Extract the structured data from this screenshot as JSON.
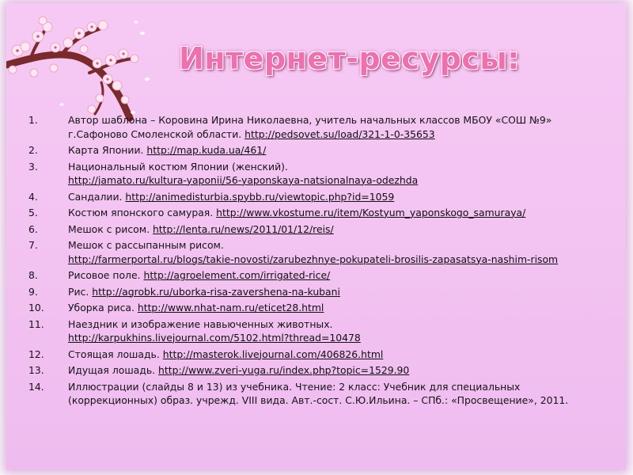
{
  "title": "Интернет-ресурсы:",
  "refs": [
    {
      "num": "1.",
      "text": "Автор шаблона – Коровина Ирина Николаевна, учитель начальных классов МБОУ «СОШ №9» г.Сафоново Смоленской области. ",
      "link": "http://pedsovet.su/load/321-1-0-35653",
      "after": ""
    },
    {
      "num": "2.",
      "text": "Карта Японии. ",
      "link": "http://map.kuda.ua/461/",
      "after": ""
    },
    {
      "num": "3.",
      "text": "Национальный костюм Японии (женский).",
      "link": "http://jamato.ru/kultura-yaponii/56-yaponskaya-natsionalnaya-odezhda",
      "after": ""
    },
    {
      "num": "4.",
      "text": "Сандалии. ",
      "link": "http://animedisturbia.spybb.ru/viewtopic.php?id=1059",
      "after": ""
    },
    {
      "num": "5.",
      "text": "Костюм японского самурая. ",
      "link": "http://www.vkostume.ru/item/Kostyum_yaponskogo_samuraya/",
      "after": ""
    },
    {
      "num": "6.",
      "text": "Мешок с рисом. ",
      "link": "http://lenta.ru/news/2011/01/12/reis/",
      "after": ""
    },
    {
      "num": "7.",
      "text": "Мешок с рассыпанным рисом.",
      "link": "http://farmerportal.ru/blogs/takie-novosti/zarubezhnye-pokupateli-brosilis-zapasatsya-nashim-risom",
      "after": ""
    },
    {
      "num": "8.",
      "text": "Рисовое поле. ",
      "link": "http://agroelement.com/irrigated-rice/",
      "after": ""
    },
    {
      "num": "9.",
      "text": "Рис. ",
      "link": "http://agrobk.ru/uborka-risa-zavershena-na-kubani",
      "after": ""
    },
    {
      "num": "10.",
      "text": "Уборка риса. ",
      "link": "http://www.nhat-nam.ru/eticet28.html",
      "after": ""
    },
    {
      "num": "11.",
      "text": "Наездник и изображение навьюченных животных.",
      "link": "http://karpukhins.livejournal.com/5102.html?thread=10478",
      "after": ""
    },
    {
      "num": "12.",
      "text": "Стоящая лошадь. ",
      "link": "http://masterok.livejournal.com/406826.html",
      "after": ""
    },
    {
      "num": "13.",
      "text": "Идущая лошадь. ",
      "link": "http://www.zveri-yuga.ru/index.php?topic=1529.90",
      "after": ""
    },
    {
      "num": "14.",
      "text": "Иллюстрации (слайды 8 и 13) из учебника. Чтение: 2 класс: Учебник для специальных (коррекционных) образ. учрежд. VIII вида. Авт.-сост. С.Ю.Ильина. – СПб.: «Просвещение», 2011.",
      "link": "",
      "after": ""
    }
  ],
  "colors": {
    "background": "#f3c3f1",
    "title": "#f06fae",
    "text": "#141414"
  }
}
